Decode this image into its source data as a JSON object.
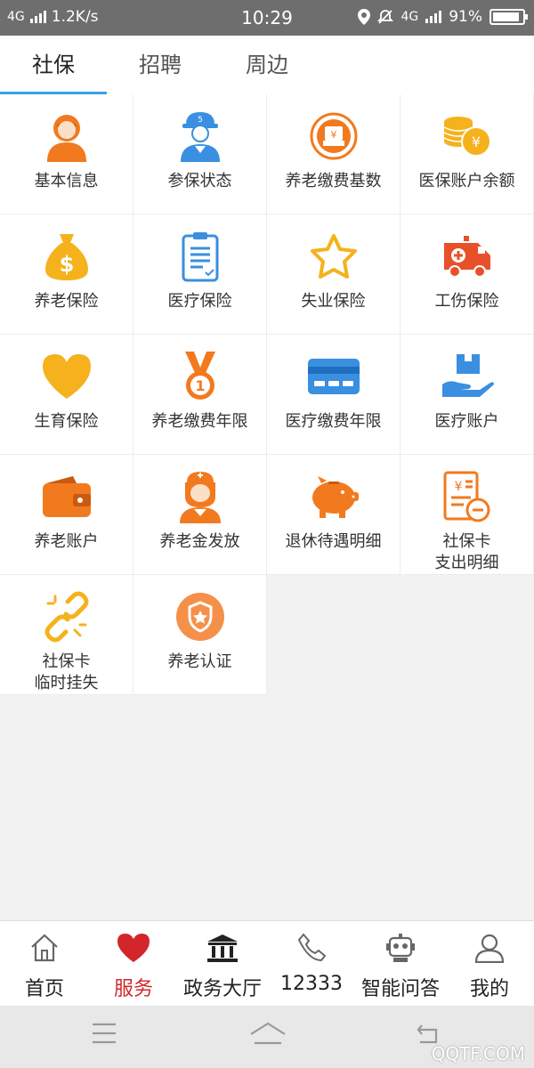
{
  "status_bar": {
    "network_left": "4G",
    "speed": "1.2K/s",
    "time": "10:29",
    "network_right": "4G",
    "battery_text": "91%",
    "battery_level": 0.91
  },
  "tabs": [
    {
      "label": "社保",
      "active": true
    },
    {
      "label": "招聘",
      "active": false
    },
    {
      "label": "周边",
      "active": false
    }
  ],
  "grid_items": [
    {
      "label": "基本信息",
      "icon": "person-icon"
    },
    {
      "label": "参保状态",
      "icon": "worker-icon"
    },
    {
      "label": "养老缴费基数",
      "icon": "payment-icon"
    },
    {
      "label": "医保账户余额",
      "icon": "coins-icon"
    },
    {
      "label": "养老保险",
      "icon": "money-bag-icon"
    },
    {
      "label": "医疗保险",
      "icon": "clipboard-icon"
    },
    {
      "label": "失业保险",
      "icon": "star-icon"
    },
    {
      "label": "工伤保险",
      "icon": "ambulance-icon"
    },
    {
      "label": "生育保险",
      "icon": "heart-icon"
    },
    {
      "label": "养老缴费年限",
      "icon": "medal-icon"
    },
    {
      "label": "医疗缴费年限",
      "icon": "card-icon"
    },
    {
      "label": "医疗账户",
      "icon": "hand-box-icon"
    },
    {
      "label": "养老账户",
      "icon": "wallet-icon"
    },
    {
      "label": "养老金发放",
      "icon": "nurse-icon"
    },
    {
      "label": "退休待遇明细",
      "icon": "piggy-bank-icon"
    },
    {
      "label_line1": "社保卡",
      "label_line2": "支出明细",
      "icon": "receipt-icon"
    },
    {
      "label_line1": "社保卡",
      "label_line2": "临时挂失",
      "icon": "broken-link-icon"
    },
    {
      "label": "养老认证",
      "icon": "shield-star-icon"
    }
  ],
  "bottom_nav": [
    {
      "label": "首页",
      "icon": "home-icon",
      "active": false
    },
    {
      "label": "服务",
      "icon": "heart-icon",
      "active": true
    },
    {
      "label": "政务大厅",
      "icon": "government-building-icon",
      "active": false
    },
    {
      "label": "12333",
      "icon": "phone-icon",
      "active": false
    },
    {
      "label": "智能问答",
      "icon": "robot-icon",
      "active": false
    },
    {
      "label": "我的",
      "icon": "user-icon",
      "active": false
    }
  ],
  "watermark": "QQTF.COM",
  "colors": {
    "orange": "#f27a1e",
    "yellow": "#f5b21c",
    "blue": "#3a8fe0",
    "accent_red": "#d3262b",
    "tab_indicator": "#3aa0e6"
  }
}
